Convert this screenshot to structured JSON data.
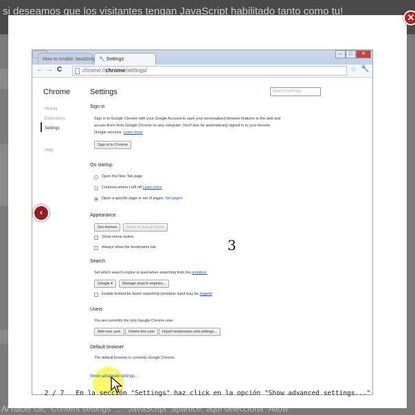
{
  "background": {
    "top_text": "si deseamos que los visitantes tengan JavaScript habilitado tanto como tu!",
    "bottom_text": "Al hacer clic \"Content settings\" ... \"JavaScript\" aparece, aquí selecciona \"Allow"
  },
  "lightbox": {
    "close_label": "✕",
    "prev_label": "‹",
    "slide_number": "3",
    "counter": "2 / 7",
    "caption": "En la sección \"Settings\" haz click en la opción \"Show advanced settings...\""
  },
  "browser": {
    "tabs": [
      {
        "label": "How to enable JavaScript"
      },
      {
        "label": "Settings"
      }
    ],
    "url_prefix": "chrome://",
    "url_bold": "chrome",
    "url_suffix": "/settings/"
  },
  "settings": {
    "sidebar_title": "Chrome",
    "sidebar_items": [
      "History",
      "Extensions",
      "Settings",
      "Help"
    ],
    "title": "Settings",
    "search_placeholder": "Search settings",
    "signin": {
      "heading": "Sign in",
      "line1": "Sign in to Google Chrome with your Google Account to save your personalized browser features to the web and",
      "line2": "access them from Google Chrome on any computer. You'll also be automatically signed in to your favorite",
      "line3": "Google services.",
      "learn_more": "Learn more",
      "button": "Sign in to Chrome"
    },
    "startup": {
      "heading": "On startup",
      "options": [
        "Open the New Tab page",
        "Continue where I left off",
        "Open a specific page or set of pages."
      ],
      "continue_link": "Learn more",
      "set_pages": "Set pages"
    },
    "appearance": {
      "heading": "Appearance",
      "get_themes": "Get themes",
      "reset_theme": "Reset to default theme",
      "home_button": "Show Home button",
      "bookmarks_bar": "Always show the bookmarks bar"
    },
    "search": {
      "heading": "Search",
      "line": "Set which search engine is used when searching from the",
      "omnibox": "omnibox.",
      "engine": "Google ▾",
      "manage": "Manage search engines...",
      "instant": "Enable Instant for faster searching (omnibox input may be",
      "logged": "logged)"
    },
    "users": {
      "heading": "Users",
      "line": "You are currently the only Google Chrome user.",
      "add": "Add new user",
      "delete": "Delete this user",
      "import": "Import bookmarks and settings..."
    },
    "default_browser": {
      "heading": "Default browser",
      "line": "The default browser is currently Google Chrome."
    },
    "advanced_link": "Show advanced settings..."
  }
}
